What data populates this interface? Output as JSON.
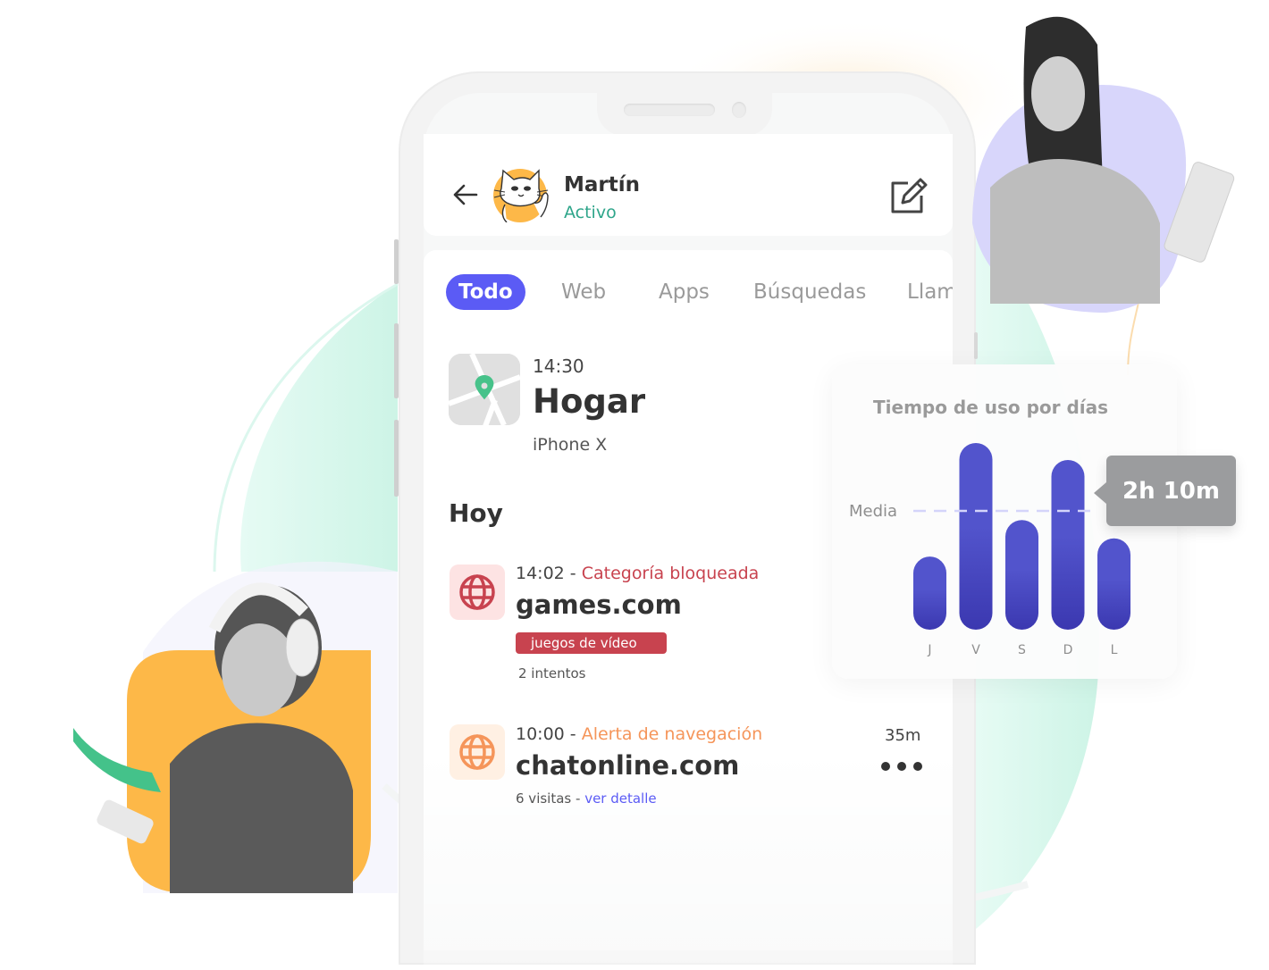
{
  "header": {
    "back_label": "Atrás",
    "user_name": "Martín",
    "user_status": "Activo",
    "avatar_icon": "cat-avatar-icon",
    "edit_icon": "edit-icon"
  },
  "tabs": [
    {
      "label": "Todo",
      "active": true
    },
    {
      "label": "Web",
      "active": false
    },
    {
      "label": "Apps",
      "active": false
    },
    {
      "label": "Búsquedas",
      "active": false
    },
    {
      "label": "Llam",
      "active": false
    }
  ],
  "location": {
    "time": "14:30",
    "place": "Hogar",
    "device": "iPhone X",
    "icon": "map-pin-icon"
  },
  "today": {
    "title": "Hoy",
    "items": [
      {
        "time": "14:02",
        "separator": " - ",
        "category": "Categoría bloqueada",
        "category_color": "#c8434f",
        "site": "games.com",
        "tag": "juegos de vídeo",
        "detail": "2 intentos",
        "icon": "globe-icon",
        "icon_color": "#c8434f",
        "icon_bg": "#fde3e3"
      },
      {
        "time": "10:00",
        "separator": " - ",
        "category": "Alerta de navegación",
        "category_color": "#f5955a",
        "site": "chatonline.com",
        "detail": "6 visitas",
        "detail_separator": " - ",
        "link": "ver detalle",
        "duration": "35m",
        "icon": "globe-icon",
        "icon_color": "#f5955a",
        "icon_bg": "#fff0e3"
      }
    ]
  },
  "colors": {
    "accent": "#5b5bf5",
    "active_status": "#2ea58a",
    "bar_top": "#5254cc",
    "bar_bottom": "#3b38b0",
    "mean_line": "#d4d4fa",
    "tooltip_bg": "#9b9c9e"
  },
  "chart_data": {
    "type": "bar",
    "title": "Tiempo de uso por días",
    "categories": [
      "J",
      "V",
      "S",
      "D",
      "L"
    ],
    "values": [
      56,
      143,
      84,
      130,
      70
    ],
    "unit": "minutes",
    "mean_label": "Media",
    "mean_value": 91,
    "highlight": {
      "category": "D",
      "label": "2h 10m"
    },
    "ylim": [
      0,
      143
    ],
    "grid": false,
    "xlabel": "",
    "ylabel": ""
  }
}
